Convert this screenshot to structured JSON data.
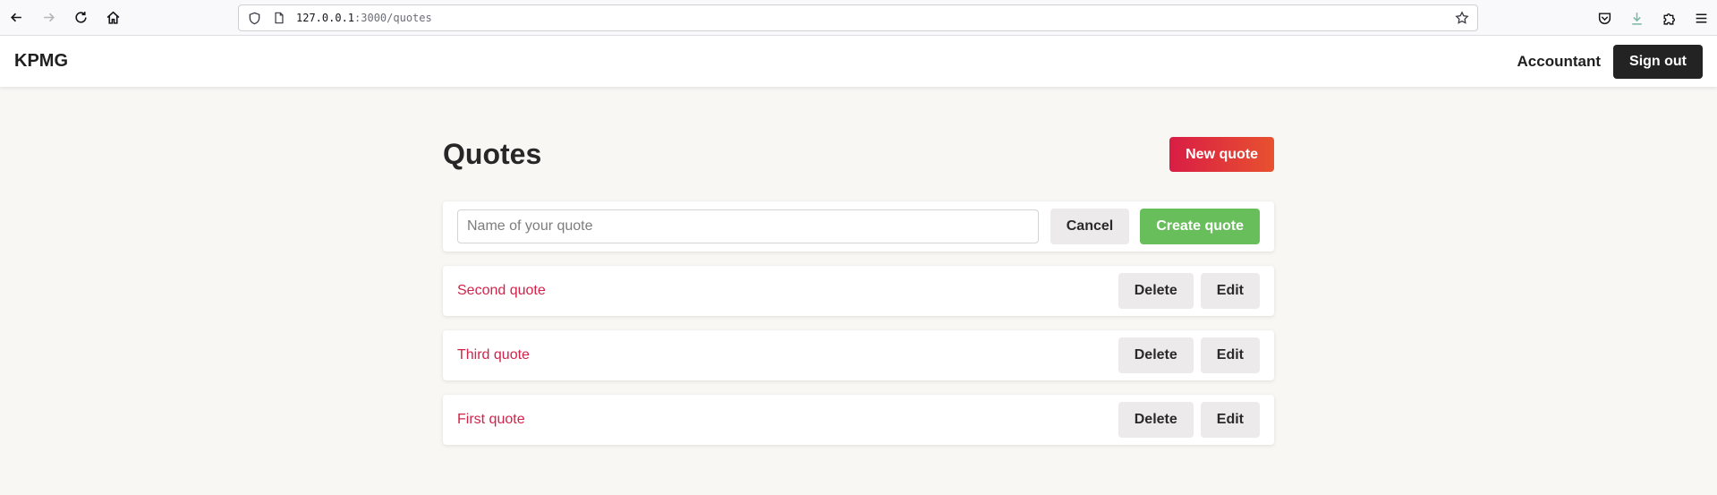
{
  "browser": {
    "url_host": "127.0.0.1",
    "url_rest": ":3000/quotes"
  },
  "nav": {
    "brand": "KPMG",
    "role": "Accountant",
    "signout_label": "Sign out"
  },
  "page": {
    "title": "Quotes",
    "new_quote_label": "New quote"
  },
  "form": {
    "placeholder": "Name of your quote",
    "value": "",
    "cancel_label": "Cancel",
    "create_label": "Create quote"
  },
  "quotes": [
    {
      "name": "Second quote",
      "delete_label": "Delete",
      "edit_label": "Edit"
    },
    {
      "name": "Third quote",
      "delete_label": "Delete",
      "edit_label": "Edit"
    },
    {
      "name": "First quote",
      "delete_label": "Delete",
      "edit_label": "Edit"
    }
  ],
  "colors": {
    "accent": "#d91d45",
    "accent_end": "#e8512f",
    "success": "#69be5c",
    "dark": "#232323",
    "background": "#f9f7f4",
    "link": "#d2224a"
  }
}
